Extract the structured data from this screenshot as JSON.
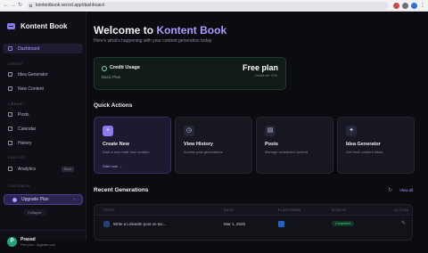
{
  "browser": {
    "url": "kontentbook.vercel.app/dashboard",
    "back": "←",
    "forward": "→",
    "reload": "↻",
    "menu": "⋮"
  },
  "sidebar": {
    "brand": "Kontent Book",
    "items": [
      {
        "label": "Dashboard",
        "active": true,
        "icon": "grid-icon"
      },
      {
        "label": "Idea Generator",
        "icon": "lightbulb-icon"
      },
      {
        "label": "New Content",
        "icon": "plus-icon"
      },
      {
        "label": "Posts",
        "icon": "document-icon"
      },
      {
        "label": "Calendar",
        "icon": "calendar-icon"
      },
      {
        "label": "History",
        "icon": "clock-icon"
      },
      {
        "label": "Analytics",
        "icon": "chart-icon",
        "badge": "Soon"
      }
    ],
    "sections": [
      "CREATE",
      "LIBRARY",
      "ANALYZE",
      "CUSTOMIZE"
    ],
    "upgrade_label": "Upgrade Plan",
    "collapse_label": "Collapse",
    "user": {
      "initial": "P",
      "name": "Prasad",
      "plan": "Free plan · Upgrade now"
    }
  },
  "main": {
    "title_prefix": "Welcome to ",
    "title_accent": "Kontent Book",
    "subtitle": "Here's what's happening with your content generation today.",
    "credit": {
      "title": "Credit Usage",
      "sub": "Basic Plan",
      "plan": "Free plan",
      "plan_sub": "Credits left: 0/10"
    },
    "quick_actions_title": "Quick Actions",
    "quick_actions": [
      {
        "name": "Create New",
        "desc": "Start a new draft from scratch",
        "link": "Start now →",
        "icon": "+"
      },
      {
        "name": "View History",
        "desc": "Access past generations",
        "icon": "◷"
      },
      {
        "name": "Posts",
        "desc": "Manage scheduled content",
        "icon": "▤"
      },
      {
        "name": "Idea Generator",
        "desc": "Get fresh content ideas",
        "icon": "✦"
      }
    ],
    "recent_title": "Recent Generations",
    "refresh_icon": "↻",
    "view_all": "View all",
    "table": {
      "headers": [
        "TOPIC",
        "DATE",
        "PLATFORMS",
        "STATUS",
        "ACTION"
      ],
      "rows": [
        {
          "topic": "Write a LinkedIn post on tec...",
          "date": "Mar 1, 2025",
          "status": "Completed",
          "action": "✎"
        }
      ]
    }
  },
  "colors": {
    "accent": "#a99cff",
    "sidebar_active": "#1d1c33",
    "credit_bg": "#101a16",
    "status_green": "#57d49a"
  }
}
